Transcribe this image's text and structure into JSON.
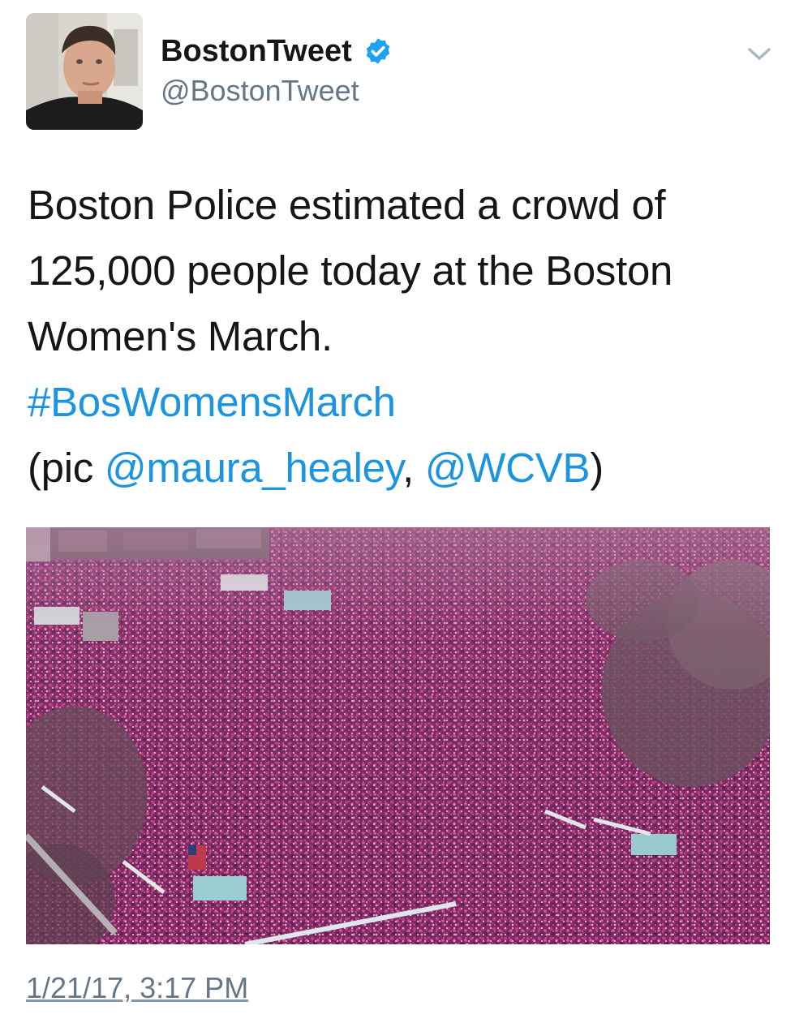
{
  "author": {
    "display_name": "BostonTweet",
    "handle": "@BostonTweet",
    "verified": true,
    "avatar_icon": "user-avatar"
  },
  "menu": {
    "icon": "chevron-down-icon"
  },
  "tweet": {
    "line1": "Boston Police estimated a crowd of",
    "line2": "125,000 people today at the Boston",
    "line3": "Women's March.",
    "hashtag": "#BosWomensMarch",
    "credit_open": "(pic ",
    "mention1": "@maura_healey",
    "credit_sep": ", ",
    "mention2": "@WCVB",
    "credit_close": ")"
  },
  "media": {
    "alt_icon": "aerial-crowd-photo"
  },
  "timestamp": "1/21/17, 3:17 PM",
  "colors": {
    "link": "#1b95e0",
    "verified_badge": "#1da1f2",
    "secondary_text": "#657786",
    "primary_text": "#14171a"
  }
}
